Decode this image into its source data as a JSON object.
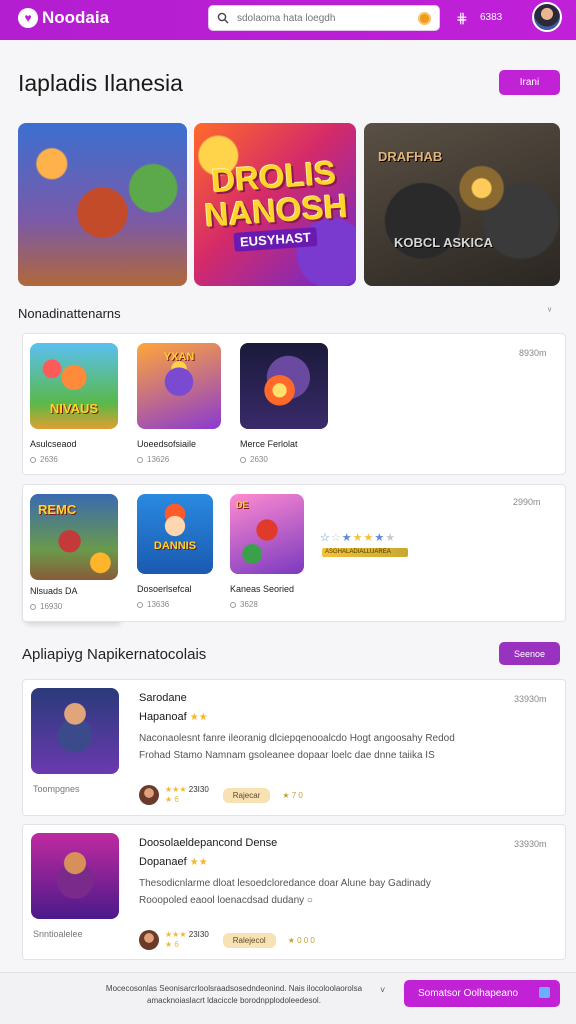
{
  "header": {
    "logo": "Noodaia",
    "search_placeholder": "sdolaoma hata loegdh",
    "cart_count": "6383"
  },
  "hero": {
    "title": "Iapladis Ilanesia",
    "button": "Irani",
    "banner2_title": "DROLIS NANOSH",
    "banner2_sub": "EUSYHAST",
    "banner3_text_top": "DRAFHAB",
    "banner3_text_bottom": "KOBCL ASKICA"
  },
  "section1": {
    "title": "Nonadinattenarns",
    "toggle": "ᵛ",
    "panel_a_meta": "8930m",
    "panel_b_meta": "2990m",
    "tiles": [
      {
        "name": "Asulcseaod",
        "stat": "2636",
        "overlay": "NIVAUS"
      },
      {
        "name": "Uoeedsofsiaile",
        "stat": "13626",
        "overlay": "YXAN"
      },
      {
        "name": "Merce Ferlolat",
        "stat": "2630",
        "overlay": ""
      },
      {
        "name": "Nlsuads DA",
        "stat": "16930",
        "overlay": "REMC"
      },
      {
        "name": "Dosoerlsefcal",
        "stat": "13636",
        "overlay": "DANNIS"
      },
      {
        "name": "Kaneas Seoried",
        "stat": "3628",
        "overlay": "DE"
      }
    ],
    "rating_badge": "ASGHALADIALLUAREA"
  },
  "section2": {
    "title": "Apliapiyg Napikernatocolais",
    "button": "Seenoe",
    "cards": [
      {
        "title": "Sarodane",
        "subtitle": "Hapanoaf",
        "desc": "Naconaolesnt fanre ileoranig dlciepqenooalcdo Hogt angoosahy Redod Frohad Stamo Namnam gsoleanee dopaar loelc dae dnne taiika IS",
        "caption": "Toompgnes",
        "meta": "33930m",
        "rating": "23I30",
        "stars_small": "★ 6",
        "pill": "Rajecar",
        "extra": "★ 7 0"
      },
      {
        "title": "Doosolaeldepancond Dense",
        "subtitle": "Dopanaef",
        "desc": "Thesodicnlarme dloat lesoedcloredance doar Alune bay Gadinady Rooopoled eaool loenacdsad dudany ○",
        "caption": "Snntioalelee",
        "meta": "33930m",
        "rating": "23I30",
        "stars_small": "★ 6",
        "pill": "Ralejecol",
        "extra": "★ 0 0 0"
      }
    ]
  },
  "footer": {
    "text": "Mocecosonlas Seonisarcrloolsraadsosedndeonind. Nais ilocoloolaorolsa amacknoiaslacrt ldaciccle borodnpplodoleedesol.",
    "chevron": "˅",
    "button": "Somatsor Oolhapeano"
  },
  "colors": {
    "accent": "#c222d5",
    "header": "#b31ed0",
    "star": "#f4b82a"
  }
}
